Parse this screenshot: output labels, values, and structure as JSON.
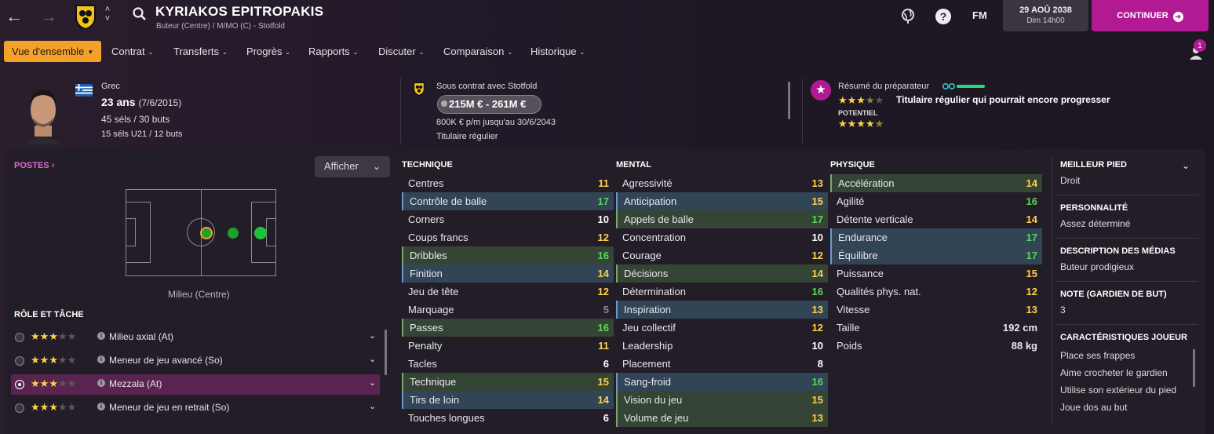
{
  "header": {
    "name": "KYRIAKOS EPITROPAKIS",
    "subtitle": "Buteur (Centre) / M/MO (C) - Stotfold",
    "fm_label": "FM",
    "date": "29 AOÛ 2038",
    "day_time": "Dim 14h00",
    "continue_label": "CONTINUER"
  },
  "menu": [
    {
      "label": "Vue d'ensemble",
      "active": true
    },
    {
      "label": "Contrat"
    },
    {
      "label": "Transferts"
    },
    {
      "label": "Progrès"
    },
    {
      "label": "Rapports"
    },
    {
      "label": "Discuter"
    },
    {
      "label": "Comparaison"
    },
    {
      "label": "Historique"
    }
  ],
  "notification_count": "1",
  "player": {
    "nationality": "Grec",
    "age": "23 ans",
    "birth": "(7/6/2015)",
    "caps": "45 séls / 30 buts",
    "u21": "15 séls U21 / 12 buts"
  },
  "contract": {
    "status": "Sous contrat avec Stotfold",
    "value": "215M € - 261M €",
    "wage": "800K € p/m jusqu'au 30/6/2043",
    "role": "Titulaire régulier"
  },
  "coach": {
    "title": "Résumé du préparateur",
    "summary": "Titulaire régulier qui pourrait encore progresser",
    "potential_label": "POTENTIEL",
    "current_stars": 3.5,
    "potential_stars": 4.5
  },
  "positions": {
    "title": "POSTES",
    "button": "Afficher",
    "label": "Milieu (Centre)"
  },
  "roles": {
    "title": "RÔLE ET TÂCHE",
    "items": [
      {
        "label": "Milieu axial (At)",
        "stars": 3,
        "selected": false
      },
      {
        "label": "Meneur de jeu avancé (So)",
        "stars": 3,
        "selected": false
      },
      {
        "label": "Mezzala (At)",
        "stars": 3,
        "selected": true
      },
      {
        "label": "Meneur de jeu en retrait (So)",
        "stars": 3,
        "selected": false
      }
    ]
  },
  "technique": {
    "title": "TECHNIQUE",
    "rows": [
      {
        "n": "Centres",
        "v": "11",
        "h": ""
      },
      {
        "n": "Contrôle de balle",
        "v": "17",
        "h": "blue"
      },
      {
        "n": "Corners",
        "v": "10",
        "h": ""
      },
      {
        "n": "Coups francs",
        "v": "12",
        "h": ""
      },
      {
        "n": "Dribbles",
        "v": "16",
        "h": "green"
      },
      {
        "n": "Finition",
        "v": "14",
        "h": "blue"
      },
      {
        "n": "Jeu de tête",
        "v": "12",
        "h": ""
      },
      {
        "n": "Marquage",
        "v": "5",
        "h": ""
      },
      {
        "n": "Passes",
        "v": "16",
        "h": "green"
      },
      {
        "n": "Penalty",
        "v": "11",
        "h": ""
      },
      {
        "n": "Tacles",
        "v": "6",
        "h": ""
      },
      {
        "n": "Technique",
        "v": "15",
        "h": "green"
      },
      {
        "n": "Tirs de loin",
        "v": "14",
        "h": "blue"
      },
      {
        "n": "Touches longues",
        "v": "6",
        "h": ""
      }
    ]
  },
  "mental": {
    "title": "MENTAL",
    "rows": [
      {
        "n": "Agressivité",
        "v": "13",
        "h": ""
      },
      {
        "n": "Anticipation",
        "v": "15",
        "h": "blue"
      },
      {
        "n": "Appels de balle",
        "v": "17",
        "h": "green"
      },
      {
        "n": "Concentration",
        "v": "10",
        "h": ""
      },
      {
        "n": "Courage",
        "v": "12",
        "h": ""
      },
      {
        "n": "Décisions",
        "v": "14",
        "h": "green"
      },
      {
        "n": "Détermination",
        "v": "16",
        "h": ""
      },
      {
        "n": "Inspiration",
        "v": "13",
        "h": "blue"
      },
      {
        "n": "Jeu collectif",
        "v": "12",
        "h": ""
      },
      {
        "n": "Leadership",
        "v": "10",
        "h": ""
      },
      {
        "n": "Placement",
        "v": "8",
        "h": ""
      },
      {
        "n": "Sang-froid",
        "v": "16",
        "h": "blue"
      },
      {
        "n": "Vision du jeu",
        "v": "15",
        "h": "green"
      },
      {
        "n": "Volume de jeu",
        "v": "13",
        "h": "green"
      }
    ]
  },
  "physique": {
    "title": "PHYSIQUE",
    "rows": [
      {
        "n": "Accélération",
        "v": "14",
        "h": "green"
      },
      {
        "n": "Agilité",
        "v": "16",
        "h": ""
      },
      {
        "n": "Détente verticale",
        "v": "14",
        "h": ""
      },
      {
        "n": "Endurance",
        "v": "17",
        "h": "blue"
      },
      {
        "n": "Équilibre",
        "v": "17",
        "h": "blue"
      },
      {
        "n": "Puissance",
        "v": "15",
        "h": ""
      },
      {
        "n": "Qualités phys. nat.",
        "v": "12",
        "h": ""
      },
      {
        "n": "Vitesse",
        "v": "13",
        "h": ""
      }
    ],
    "height_label": "Taille",
    "height": "192 cm",
    "weight_label": "Poids",
    "weight": "88 kg"
  },
  "side": {
    "foot_title": "MEILLEUR PIED",
    "foot": "Droit",
    "pers_title": "PERSONNALITÉ",
    "pers": "Assez déterminé",
    "media_title": "DESCRIPTION DES MÉDIAS",
    "media": "Buteur prodigieux",
    "gk_title": "NOTE (GARDIEN DE BUT)",
    "gk": "3",
    "traits_title": "CARACTÉRISTIQUES JOUEUR",
    "traits": [
      "Place ses frappes",
      "Aime crocheter le gardien",
      "Utilise son extérieur du pied",
      "Joue dos au but"
    ]
  }
}
